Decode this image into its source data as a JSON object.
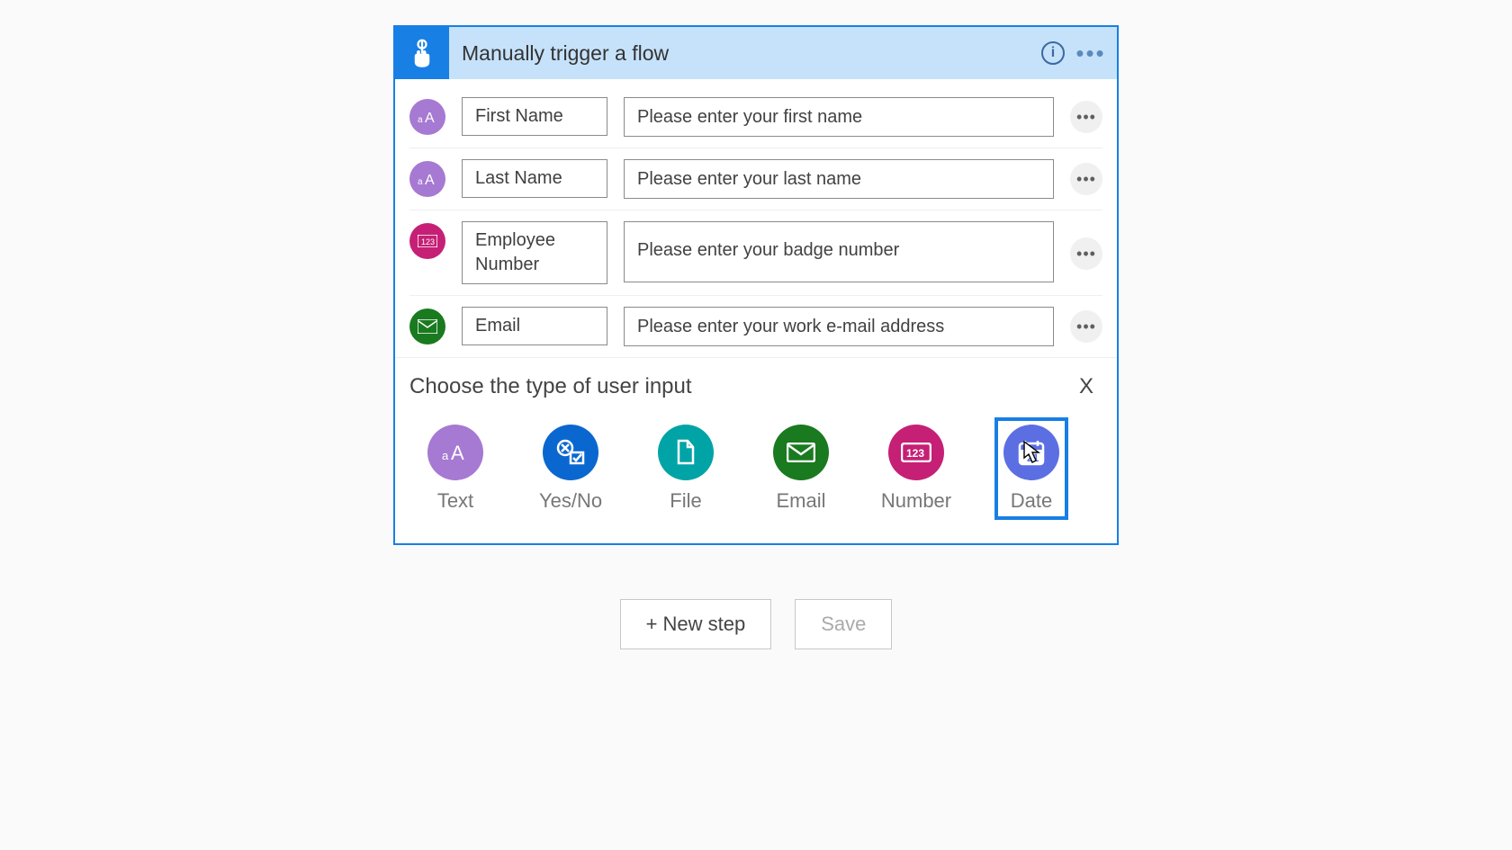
{
  "trigger": {
    "title": "Manually trigger a flow",
    "info_symbol": "i",
    "inputs": [
      {
        "type": "text",
        "name": "First Name",
        "prompt": "Please enter your first name",
        "icon": "text-icon"
      },
      {
        "type": "text",
        "name": "Last Name",
        "prompt": "Please enter your last name",
        "icon": "text-icon"
      },
      {
        "type": "number",
        "name": "Employee Number",
        "prompt": "Please enter your badge number",
        "icon": "number-icon"
      },
      {
        "type": "email",
        "name": "Email",
        "prompt": "Please enter your work e-mail address",
        "icon": "email-icon"
      }
    ]
  },
  "chooser": {
    "heading": "Choose the type of user input",
    "close_label": "X",
    "options": [
      {
        "id": "text",
        "label": "Text"
      },
      {
        "id": "yesno",
        "label": "Yes/No"
      },
      {
        "id": "file",
        "label": "File"
      },
      {
        "id": "email",
        "label": "Email"
      },
      {
        "id": "number",
        "label": "Number"
      },
      {
        "id": "date",
        "label": "Date"
      }
    ],
    "selected": "date"
  },
  "footer": {
    "new_step": "+ New step",
    "save": "Save"
  }
}
